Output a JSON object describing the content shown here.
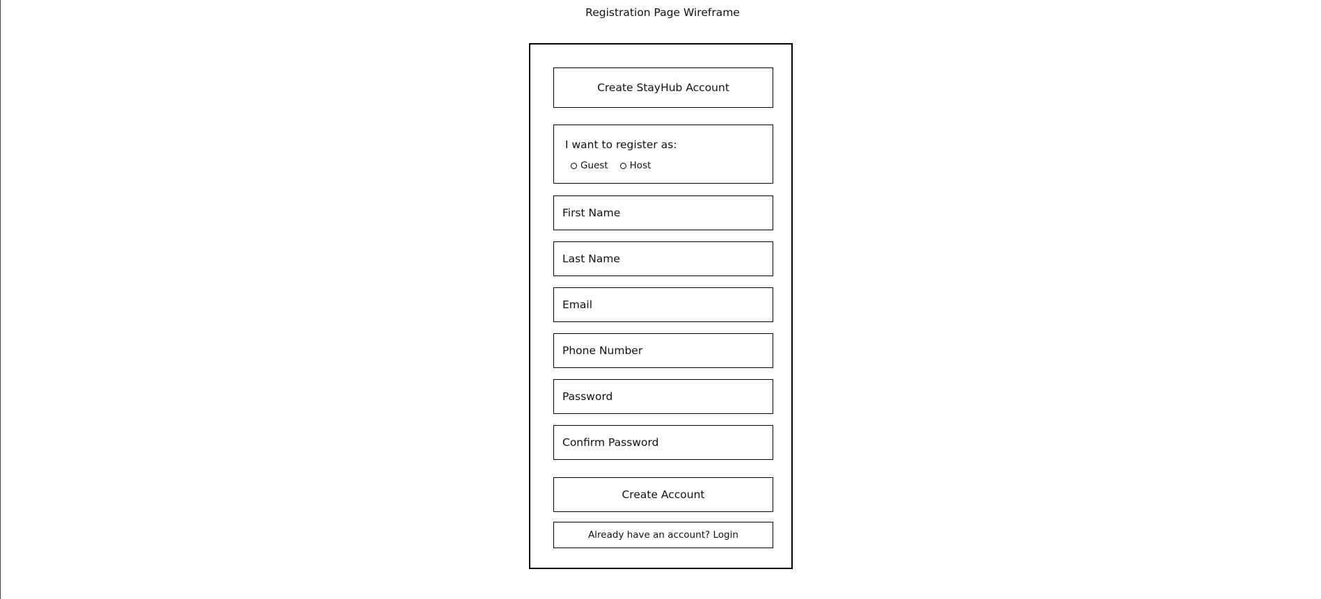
{
  "page": {
    "title": "Registration Page Wireframe"
  },
  "form": {
    "header": "Create StayHub Account",
    "role": {
      "label": "I want to register as:",
      "options": [
        "Guest",
        "Host"
      ]
    },
    "fields": [
      {
        "label": "First Name"
      },
      {
        "label": "Last Name"
      },
      {
        "label": "Email"
      },
      {
        "label": "Phone Number"
      },
      {
        "label": "Password"
      },
      {
        "label": "Confirm Password"
      }
    ],
    "submit_label": "Create Account",
    "login_link": "Already have an account? Login"
  }
}
